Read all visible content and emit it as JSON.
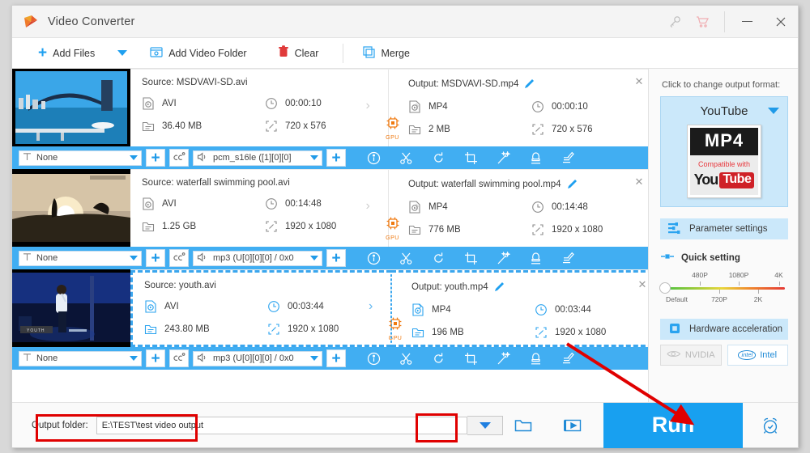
{
  "window": {
    "title": "Video Converter",
    "title_icons": [
      "key-icon",
      "cart-icon"
    ],
    "minimize": "minimize-icon",
    "close": "close-icon"
  },
  "toolbar": {
    "add_files": "Add Files",
    "add_files_caret": "chevron-down-icon",
    "add_video_folder": "Add Video Folder",
    "clear": "Clear",
    "merge": "Merge"
  },
  "files": [
    {
      "thumb": "sydney-harbour-bridge",
      "thumb_caption": "",
      "selected": false,
      "source": {
        "name": "Source: MSDVAVI-SD.avi",
        "format": "AVI",
        "duration": "00:00:10",
        "size": "36.40 MB",
        "resolution": "720 x 576"
      },
      "output": {
        "name": "Output: MSDVAVI-SD.mp4",
        "format": "MP4",
        "duration": "00:00:10",
        "size": "2 MB",
        "resolution": "720 x 576"
      },
      "gpu_label": "GPU",
      "strip": {
        "subtitle": "None",
        "audio": "pcm_s16le ([1][0][0]"
      }
    },
    {
      "thumb": "sunset-silhouette",
      "thumb_caption": "",
      "selected": false,
      "source": {
        "name": "Source: waterfall swimming pool.avi",
        "format": "AVI",
        "duration": "00:14:48",
        "size": "1.25 GB",
        "resolution": "1920 x 1080"
      },
      "output": {
        "name": "Output: waterfall swimming pool.mp4",
        "format": "MP4",
        "duration": "00:14:48",
        "size": "776 MB",
        "resolution": "1920 x 1080"
      },
      "gpu_label": "GPU",
      "strip": {
        "subtitle": "None",
        "audio": "mp3 (U[0][0][0] / 0x0"
      }
    },
    {
      "thumb": "concert-stage",
      "thumb_caption": "YOUTH",
      "selected": true,
      "source": {
        "name": "Source: youth.avi",
        "format": "AVI",
        "duration": "00:03:44",
        "size": "243.80 MB",
        "resolution": "1920 x 1080"
      },
      "output": {
        "name": "Output: youth.mp4",
        "format": "MP4",
        "duration": "00:03:44",
        "size": "196 MB",
        "resolution": "1920 x 1080"
      },
      "gpu_label": "GPU",
      "strip": {
        "subtitle": "None",
        "audio": "mp3 (U[0][0][0] / 0x0"
      }
    }
  ],
  "strip_icons": [
    "info-icon",
    "cut-icon",
    "rotate-icon",
    "crop-icon",
    "effect-icon",
    "watermark-icon",
    "subtitle-icon"
  ],
  "sidebar": {
    "hint": "Click to change output format:",
    "format_name": "YouTube",
    "format_badge": "MP4",
    "compatible_text": "Compatible with",
    "brand_you": "You",
    "brand_tube": "Tube",
    "parameter_settings": "Parameter settings",
    "quick_setting": "Quick setting",
    "slider": {
      "top_labels": [
        "480P",
        "1080P",
        "4K"
      ],
      "bottom_labels": [
        "Default",
        "720P",
        "2K"
      ],
      "value": "Default"
    },
    "hardware_acceleration": "Hardware acceleration",
    "gpu_vendors": [
      {
        "label": "NVIDIA",
        "enabled": false
      },
      {
        "label": "Intel",
        "enabled": true
      }
    ]
  },
  "bottom": {
    "output_folder_label": "Output folder:",
    "output_folder_value": "E:\\TEST\\test video output",
    "dropdown": "chevron-down-icon",
    "open_folder": "folder-icon",
    "media_icon": "video-folder-icon",
    "run_label": "Run",
    "alarm": "alarm-icon"
  },
  "colors": {
    "accent": "#18a0f0",
    "strip": "#41aef2",
    "sidebar_card": "#cbe8fa",
    "gpu_orange": "#f07a10",
    "annotation_red": "#e00000"
  }
}
